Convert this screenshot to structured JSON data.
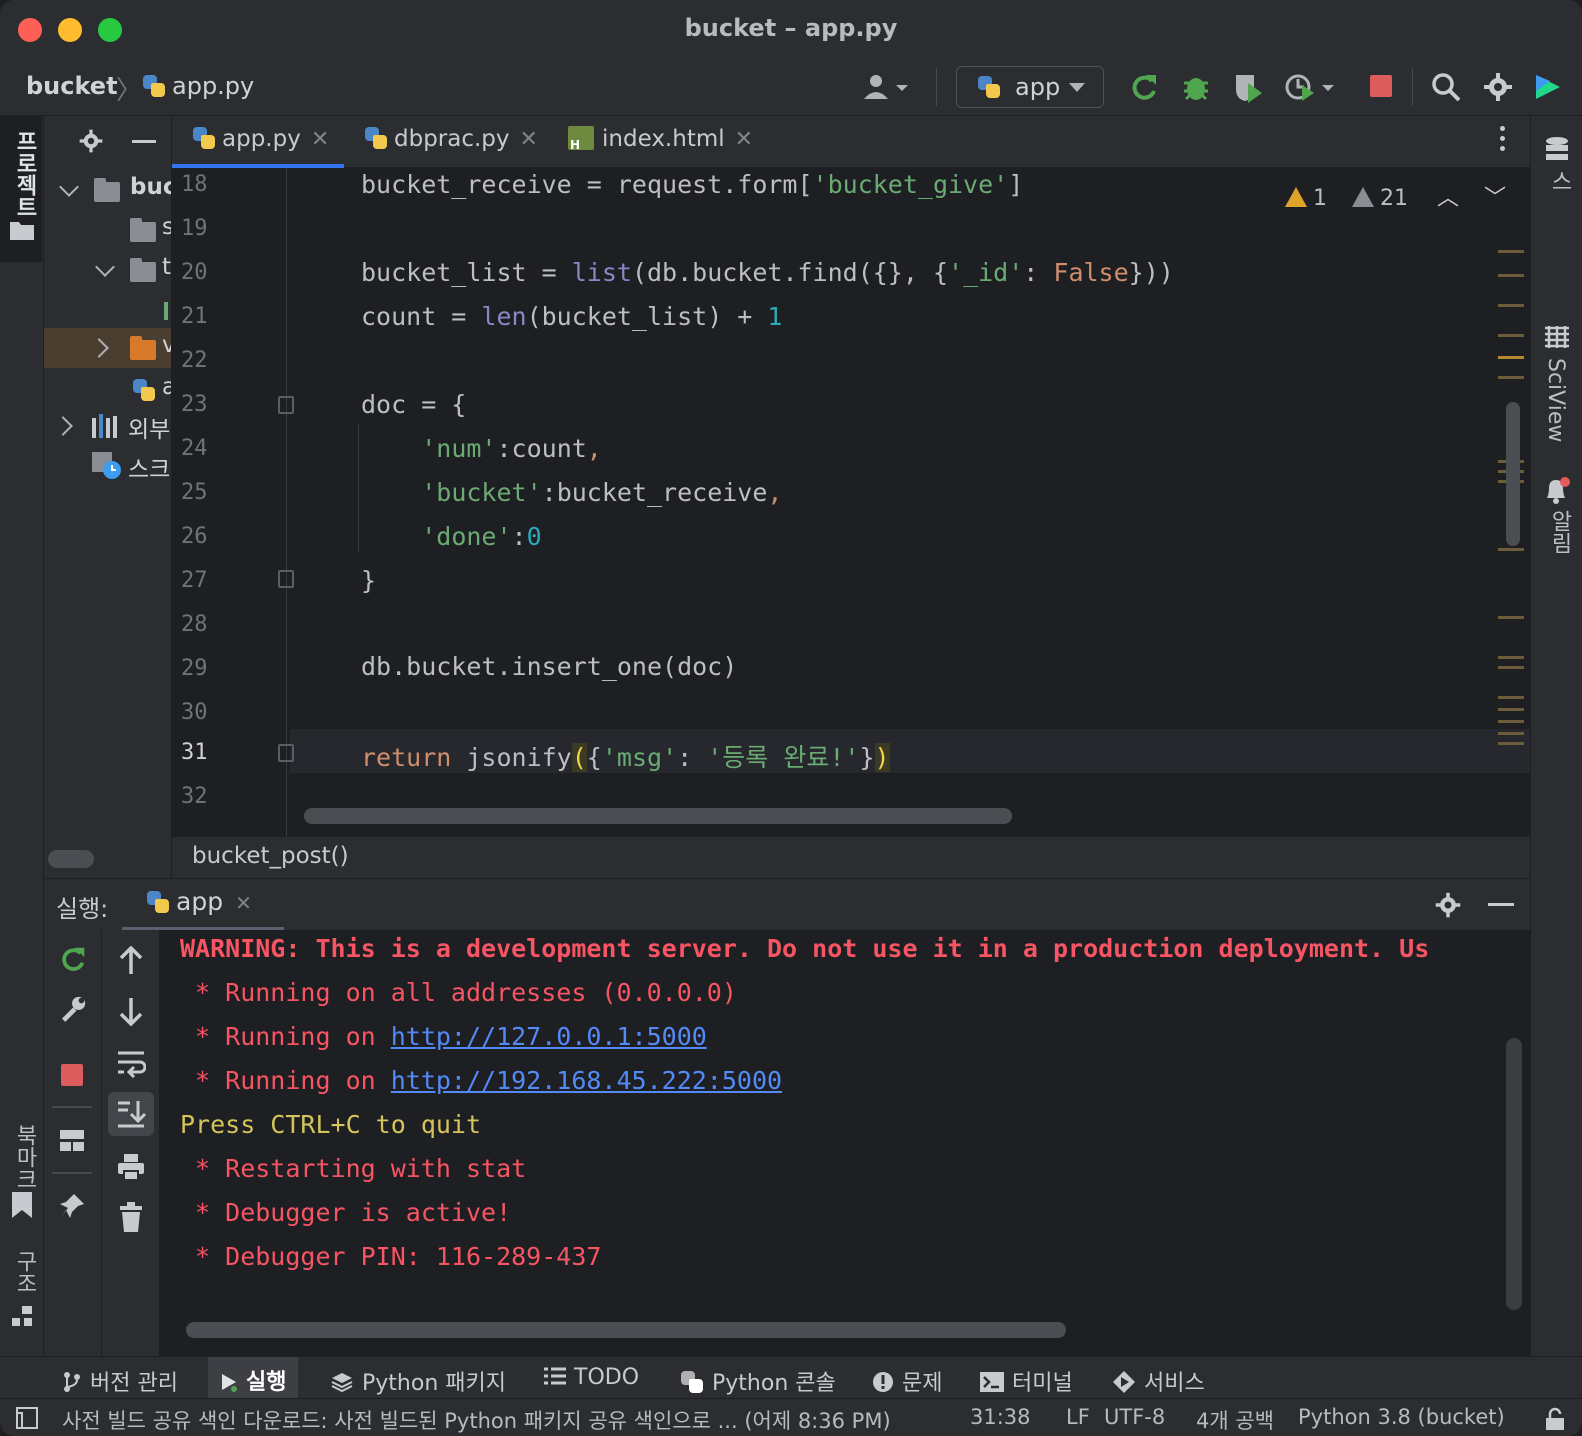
{
  "window": {
    "title": "bucket – app.py"
  },
  "nav": {
    "project": "bucket",
    "file": "app.py",
    "run_config": "app"
  },
  "left_stripe": {
    "project_label": "프로젝트",
    "bookmarks_label": "북마크",
    "structure_label": "구조"
  },
  "right_stripe": {
    "database_label": "데이터베이스",
    "sciview_label": "SciView",
    "notifications_label": "알림"
  },
  "project_tree": {
    "rows": [
      {
        "label": "buc",
        "kind": "folder",
        "expanded": true
      },
      {
        "label": "s",
        "kind": "folder"
      },
      {
        "label": "t",
        "kind": "folder",
        "expanded": true
      },
      {
        "label": "",
        "kind": "file"
      },
      {
        "label": "v",
        "kind": "folder-orange"
      },
      {
        "label": "a",
        "kind": "py"
      },
      {
        "label": "외부",
        "kind": "library"
      },
      {
        "label": "스크",
        "kind": "scratch"
      }
    ]
  },
  "tabs": [
    {
      "label": "app.py",
      "selected": true
    },
    {
      "label": "dbprac.py",
      "selected": false
    },
    {
      "label": "index.html",
      "selected": false
    }
  ],
  "inspections": {
    "warnings": "1",
    "weak_warnings": "21"
  },
  "editor": {
    "line_numbers": [
      "18",
      "19",
      "20",
      "21",
      "22",
      "23",
      "24",
      "25",
      "26",
      "27",
      "28",
      "29",
      "30",
      "31",
      "32"
    ],
    "current_line": "31"
  },
  "breadcrumb": {
    "function": "bucket_post()"
  },
  "run": {
    "label": "실행:",
    "tab": "app",
    "console": {
      "warning": "WARNING: This is a development server. Do not use it in a production deployment. Us",
      "line1": " * Running on all addresses (0.0.0.0)",
      "line2_prefix": " * Running on ",
      "line2_link": "http://127.0.0.1:5000",
      "line3_prefix": " * Running on ",
      "line3_link": "http://192.168.45.222:5000",
      "line4": "Press CTRL+C to quit",
      "line5": " * Restarting with stat",
      "line6": " * Debugger is active!",
      "line7": " * Debugger PIN: 116-289-437"
    }
  },
  "tool_windows": [
    {
      "label": "버전 관리",
      "icon": "git-branch-icon"
    },
    {
      "label": "실행",
      "icon": "run-icon",
      "active": true
    },
    {
      "label": "Python 패키지",
      "icon": "layers-icon"
    },
    {
      "label": "TODO",
      "icon": "list-icon"
    },
    {
      "label": "Python 콘솔",
      "icon": "python-icon"
    },
    {
      "label": "문제",
      "icon": "problems-icon"
    },
    {
      "label": "터미널",
      "icon": "terminal-icon"
    },
    {
      "label": "서비스",
      "icon": "services-icon"
    }
  ],
  "status": {
    "message": "사전 빌드 공유 색인 다운로드: 사전 빌드된 Python 패키지 공유 색인으로 ... (어제 8:36 PM)",
    "position": "31:38",
    "line_sep": "LF",
    "encoding": "UTF-8",
    "indent": "4개 공백",
    "interpreter": "Python 3.8 (bucket)"
  },
  "colors": {
    "accent": "#3574f0",
    "error": "#f75464",
    "link": "#548af7",
    "keyword": "#cf8e6d",
    "string": "#6aab73"
  }
}
